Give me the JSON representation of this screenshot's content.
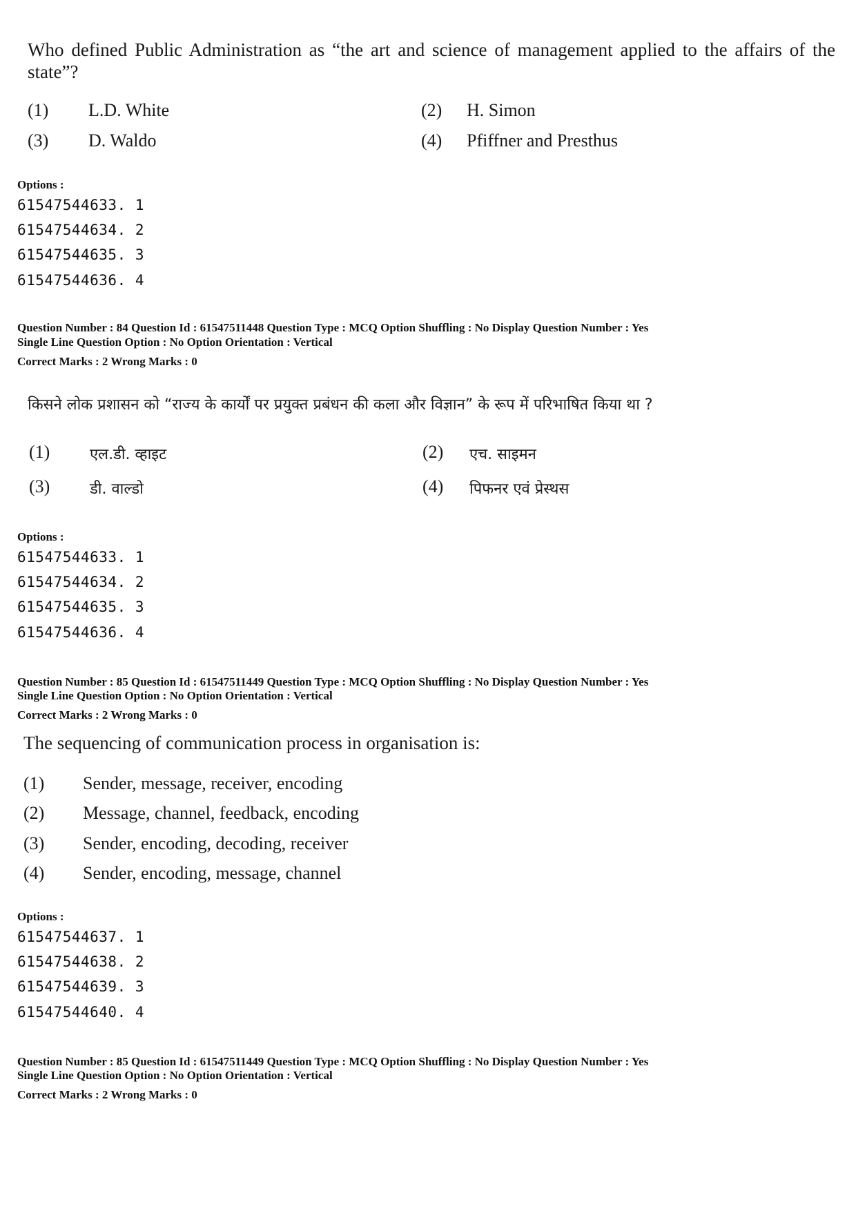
{
  "block1": {
    "question_text": "Who defined Public Administration as “the art and science of management applied to the affairs of the state”?",
    "options": [
      {
        "num": "(1)",
        "text": "L.D. White"
      },
      {
        "num": "(2)",
        "text": "H. Simon"
      },
      {
        "num": "(3)",
        "text": "D. Waldo"
      },
      {
        "num": "(4)",
        "text": "Pfiffner and Presthus"
      }
    ],
    "options_label": "Options :",
    "option_ids": [
      "61547544633. 1",
      "61547544634. 2",
      "61547544635. 3",
      "61547544636. 4"
    ]
  },
  "meta84": {
    "line1": "Question Number : 84  Question Id : 61547511448  Question Type : MCQ  Option Shuffling : No  Display Question Number : Yes",
    "line2": "Single Line Question Option : No  Option Orientation : Vertical",
    "line3": "Correct Marks : 2  Wrong Marks : 0"
  },
  "block2": {
    "question_text": "किसने लोक प्रशासन को “राज्य के कार्यों पर प्रयुक्त प्रबंधन की कला और विज्ञान” के रूप में परिभाषित किया था ?",
    "options": [
      {
        "num": "(1)",
        "text": "एल.डी. व्हाइट"
      },
      {
        "num": "(2)",
        "text": "एच. साइमन"
      },
      {
        "num": "(3)",
        "text": "डी. वाल्डो"
      },
      {
        "num": "(4)",
        "text": "पिफनर एवं प्रेस्थस"
      }
    ],
    "options_label": "Options :",
    "option_ids": [
      "61547544633. 1",
      "61547544634. 2",
      "61547544635. 3",
      "61547544636. 4"
    ]
  },
  "meta85a": {
    "line1": "Question Number : 85  Question Id : 61547511449  Question Type : MCQ  Option Shuffling : No  Display Question Number : Yes",
    "line2": "Single Line Question Option : No  Option Orientation : Vertical",
    "line3": "Correct Marks : 2  Wrong Marks : 0"
  },
  "block3": {
    "question_text": "The sequencing of communication process in organisation is:",
    "options": [
      {
        "num": "(1)",
        "text": "Sender, message, receiver, encoding"
      },
      {
        "num": "(2)",
        "text": "Message, channel, feedback, encoding"
      },
      {
        "num": "(3)",
        "text": "Sender, encoding, decoding, receiver"
      },
      {
        "num": "(4)",
        "text": "Sender, encoding, message, channel"
      }
    ],
    "options_label": "Options :",
    "option_ids": [
      "61547544637. 1",
      "61547544638. 2",
      "61547544639. 3",
      "61547544640. 4"
    ]
  },
  "meta85b": {
    "line1": "Question Number : 85  Question Id : 61547511449  Question Type : MCQ  Option Shuffling : No  Display Question Number : Yes",
    "line2": "Single Line Question Option : No  Option Orientation : Vertical",
    "line3": "Correct Marks : 2  Wrong Marks : 0"
  }
}
